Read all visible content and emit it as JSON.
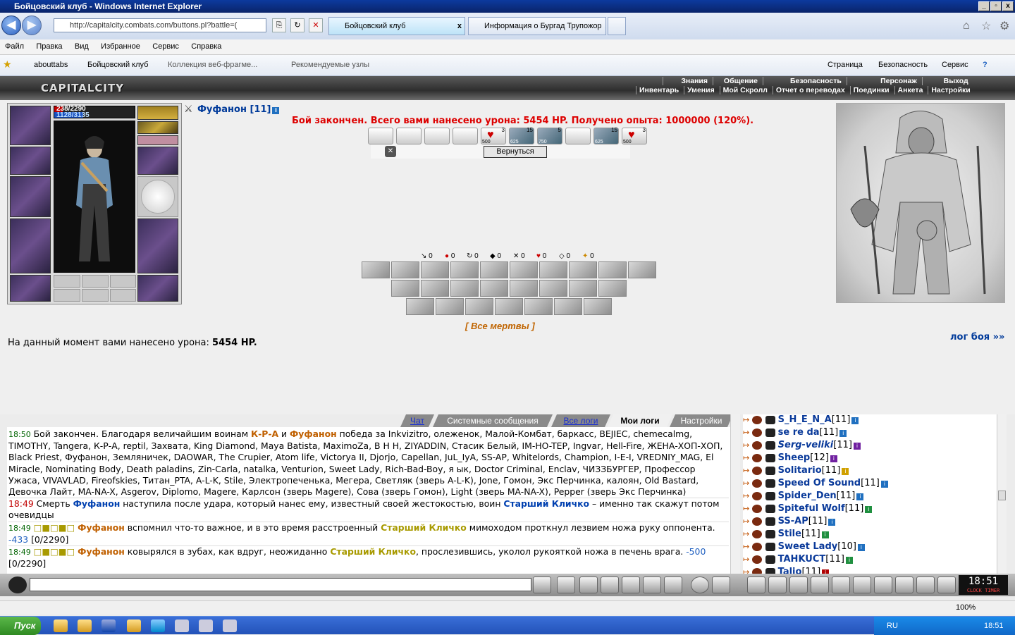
{
  "window": {
    "title": "Бойцовский клуб - Windows Internet Explorer",
    "btn_min": "_",
    "btn_max": "▫",
    "btn_close": "x"
  },
  "nav": {
    "back": "◀",
    "forward": "▶",
    "url": "http://capitalcity.combats.com/buttons.pl?battle=(",
    "tabs": [
      {
        "label": "Бойцовский клуб",
        "close": "x"
      },
      {
        "label": "Информация о Бургад Трупожор"
      }
    ],
    "home_icon": "home-icon",
    "star_icon": "star-icon",
    "gear_icon": "gear-icon"
  },
  "menu": [
    "Файл",
    "Правка",
    "Вид",
    "Избранное",
    "Сервис",
    "Справка"
  ],
  "favbar": {
    "items": [
      "abouttabs",
      "Бойцовский клуб",
      "Коллекция веб-фрагме...",
      "Рекомендуемые узлы"
    ],
    "commands": [
      "Страница",
      "Безопасность",
      "Сервис"
    ]
  },
  "game": {
    "logo": "CAPITALCITY",
    "top_menu": [
      "Знания",
      "Общение",
      "Безопасность",
      "Персонаж",
      "Выход"
    ],
    "sub_menu": [
      "Инвентарь",
      "Умения",
      "Мой Скролл",
      "Отчет о переводах",
      "Поединки",
      "Анкета",
      "Настройки"
    ],
    "char": {
      "hp": "238/2290",
      "mana": "1128/3135",
      "hp_fraction": 0.104,
      "mana_fraction": 0.36
    },
    "player": {
      "name": "Фуфанон [11]",
      "info": "i"
    },
    "result": "Бой закончен. Всего вами нанесено урона: 5454 HP. Получено опыта: 1000000 (120%).",
    "tricks": [
      {
        "n": "3",
        "sub": "500"
      },
      {
        "n": "15",
        "sub": "625"
      },
      {
        "n": "5",
        "sub": "750"
      },
      {
        "n": "15",
        "sub": "625"
      },
      {
        "n": "3",
        "sub": "500"
      }
    ],
    "back_btn": "Вернуться",
    "counters": [
      "0",
      "0",
      "0",
      "0",
      "0",
      "0",
      "0",
      "0"
    ],
    "all_dead": "[ Все мертвы ]",
    "dmg_label": "На данный момент вами нанесено урона: ",
    "dmg_value": "5454 HP.",
    "log_link": "лог боя »»"
  },
  "chat": {
    "tabs": [
      "Чат",
      "Системные сообщения",
      "Все логи",
      "Мои логи",
      "Настройки"
    ],
    "m1": {
      "time": "18:50",
      "a": "Бой закончен. Благодаря величайшим воинам ",
      "w1": "К-Р-А",
      "and": " и ",
      "w2": "Фуфанон",
      "b": " победа за Inkvizitro, олеженок, Малой-Комбат, баркасс, BEJIEC, chemecalmg, TIMOTHY, Tangera, К-Р-А, reptil, Захвата, King Diamond, Maya Batista, MaximoZa, В Н Н, ZIYADDIN, Стасик Белый, IM-HO-TEP, Ingvar, Hell-Fire, ЖЕНА-ХОП-ХОП, Black Priest, Фуфанон, Земляничек, DAOWAR, The Crupier, Atom life, Victorya II, Djorjo, Capellan, JuL_IyA, SS-AP, Whitelords, Champion, I-E-I, VREDNIY_MAG, El Miracle, Nominating Body, Death paladins, Zin-Carla, natalka, Venturion, Sweet Lady, Rich-Bad-Boy, я ык, Doctor Criminal, Enclav, ЧИЗЗБУРГЕР, Профессор Ужаса, VIVAVLAD, Fireofskies, Титан_PTA, A-L-K, Stile, Электропеченька, Мегера, Светляк (зверь A-L-K), Jone, Гомон, Экс Перчинка, калоян, Old Bastard, Девочка Лайт, MA-NA-X, Asgerov, Diplomo, Magere, Карлсон (зверь Magere), Сова (зверь Гомон), Light (зверь MA-NA-X), Pepper (зверь Экс Перчинка)"
    },
    "m2": {
      "time": "18:49",
      "a": " Смерть ",
      "w1": "Фуфанон",
      "b": " наступила после удара, который нанес ему, известный своей жестокостью, воин ",
      "w2": "Старший Кличко",
      "c": " – именно так скажут потом очевидцы"
    },
    "m3": {
      "time": "18:49",
      "boxes": "□■□■□",
      "w1": "Фуфанон",
      "a": " вспомнил что-то важное, и в это время расстроенный ",
      "w2": "Старший Кличко",
      "b": " мимоходом проткнул лезвием ножа руку оппонента. ",
      "dmg": "-433",
      "hp": " [0/2290]"
    },
    "m4": {
      "time": "18:49",
      "boxes": "□■□■□",
      "w1": "Фуфанон",
      "a": " ковырялся в зубах, как вдруг, неожиданно ",
      "w2": "Старший Кличко",
      "b": ", прослезившись, уколол рукояткой ножа в печень врага. ",
      "dmg": "-500",
      "hp": " [0/2290]"
    }
  },
  "users": [
    {
      "name": "S_H_E_N_A",
      "lvl": "[11]",
      "b": ""
    },
    {
      "name": "se re da",
      "lvl": "[11]",
      "b": ""
    },
    {
      "name": "Serg-veliki",
      "lvl": "[11]",
      "b": "p",
      "it": true
    },
    {
      "name": "Sheep",
      "lvl": "[12]",
      "b": "p"
    },
    {
      "name": "Solitario",
      "lvl": "[11]",
      "b": "y"
    },
    {
      "name": "Speed Of Sound",
      "lvl": "[11]",
      "b": ""
    },
    {
      "name": "Spider_Den",
      "lvl": "[11]",
      "b": ""
    },
    {
      "name": "Spiteful Wolf",
      "lvl": "[11]",
      "b": "g"
    },
    {
      "name": "SS-AP",
      "lvl": "[11]",
      "b": ""
    },
    {
      "name": "Stile",
      "lvl": "[11]",
      "b": "g"
    },
    {
      "name": "Sweet Lady",
      "lvl": "[10]",
      "b": ""
    },
    {
      "name": "TAHKUCT",
      "lvl": "[11]",
      "b": "g"
    },
    {
      "name": "Talio",
      "lvl": "[11]",
      "b": "r"
    }
  ],
  "bottom": {
    "clock": "18:51",
    "clock_label": "CLOCK",
    "timer": "TIMER"
  },
  "status": {
    "zoom": "100%"
  },
  "taskbar": {
    "start": "Пуск",
    "lang": "RU",
    "time": "18:51"
  }
}
